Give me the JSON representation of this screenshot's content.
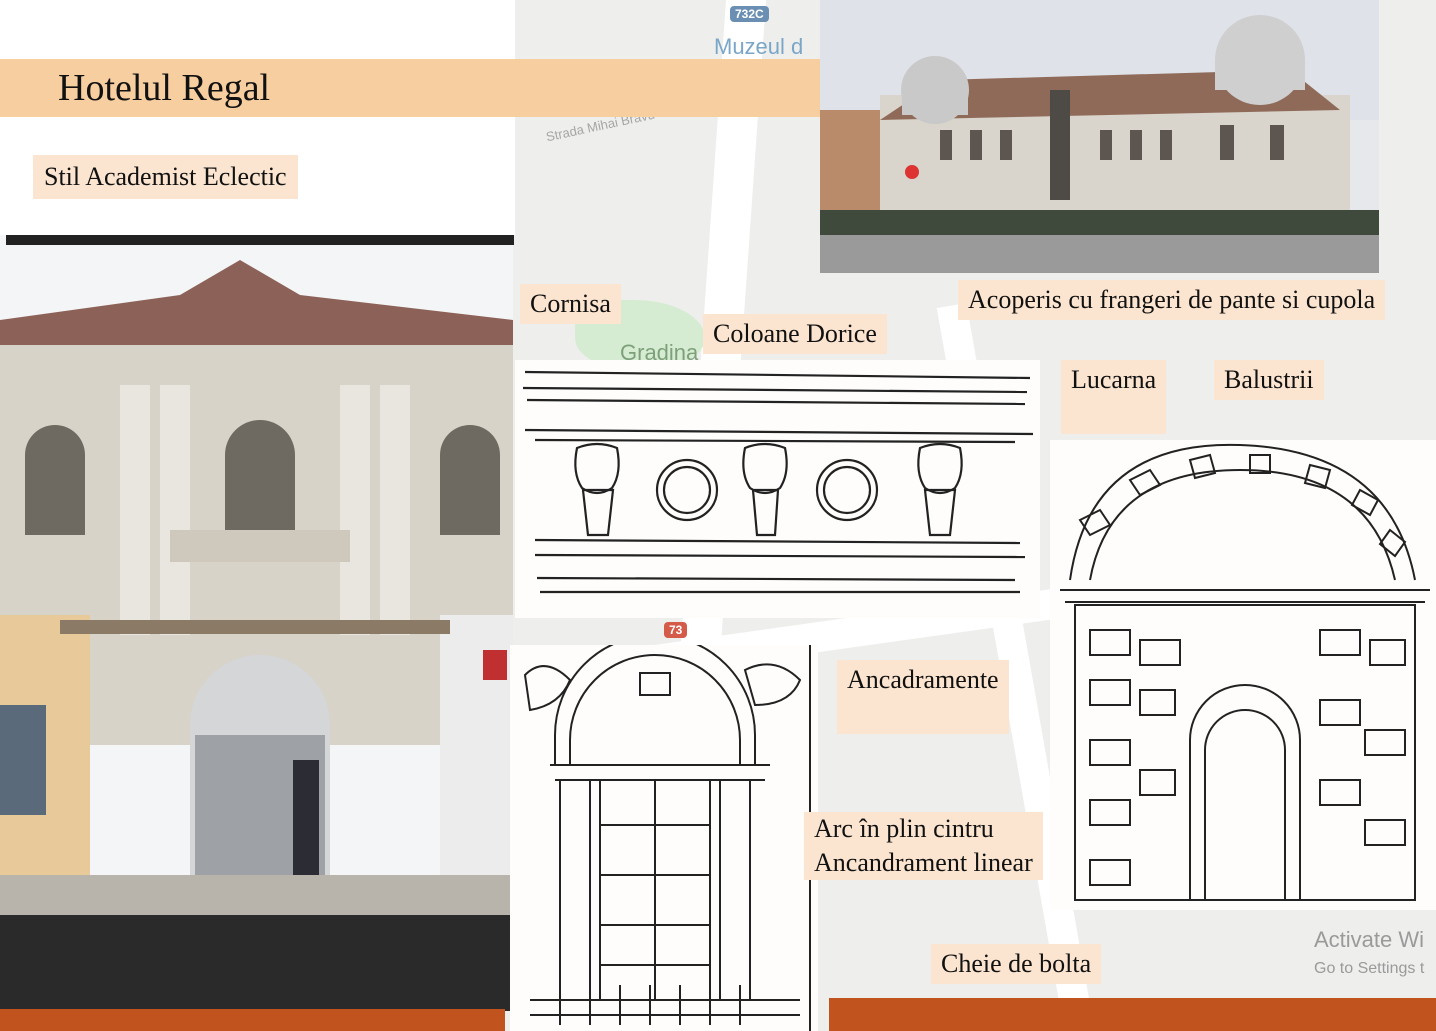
{
  "title": "Hotelul Regal",
  "style_tag": "Stil Academist Eclectic",
  "map": {
    "labels": [
      "Muzeul d",
      "Gradina",
      "Strada Mihai Bravu"
    ],
    "shields": [
      "732C",
      "73"
    ]
  },
  "annotations": {
    "cornisa": "Cornisa",
    "coloane": "Coloane Dorice",
    "acoperis": "Acoperis cu frangeri de pante si cupola",
    "lucarna": "Lucarna",
    "balustrii": "Balustrii",
    "ancadramente": "Ancadramente",
    "arc_line1": "Arc în plin cintru",
    "arc_line2": "Ancandrament linear",
    "cheie": "Cheie de bolta"
  },
  "watermark": {
    "line1": "Activate Wi",
    "line2": "Go to Settings t"
  },
  "colors": {
    "title_band": "#f7cea0",
    "label_bg": "#fbe5d0",
    "bottom_bar": "#c0531e"
  }
}
